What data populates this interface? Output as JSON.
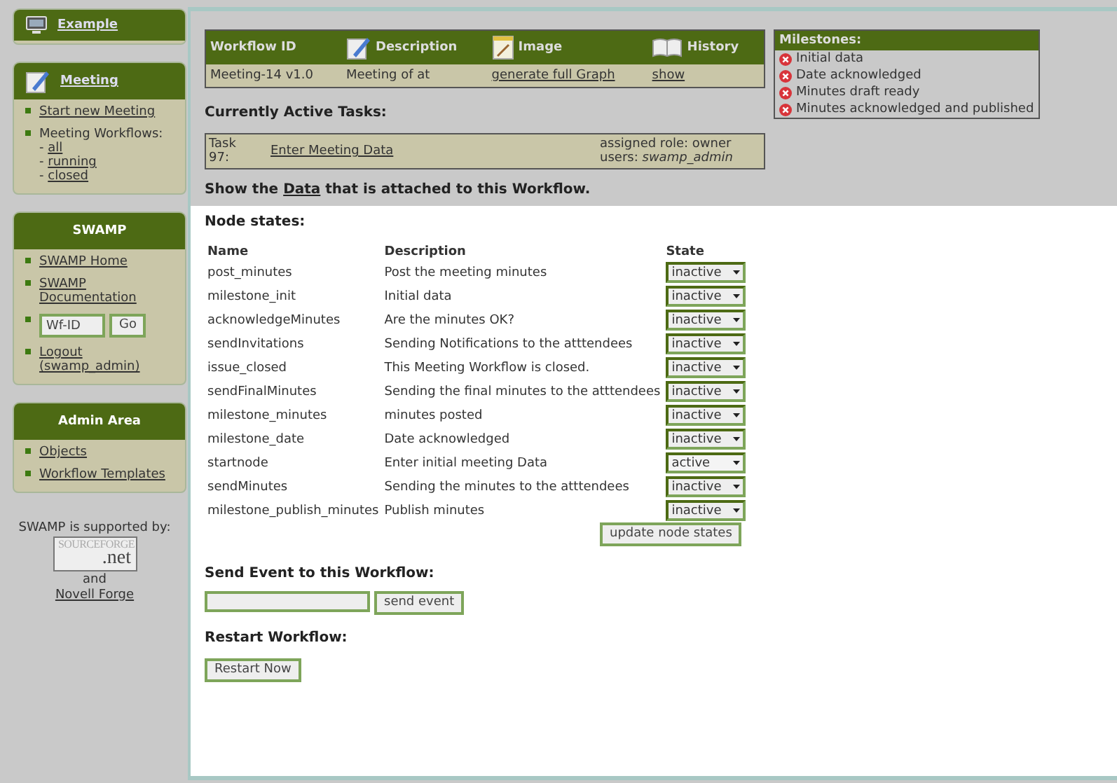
{
  "sidebar": {
    "example_box": {
      "title": "Example"
    },
    "meeting_box": {
      "title": "Meeting",
      "items": [
        {
          "kind": "link",
          "label": "Start new Meeting"
        },
        {
          "kind": "group",
          "label": "Meeting Workflows:",
          "marker": "-",
          "links": [
            "all",
            "running",
            "closed"
          ]
        }
      ]
    },
    "swamp_box": {
      "title": "SWAMP",
      "items": [
        {
          "kind": "link",
          "label": "SWAMP Home"
        },
        {
          "kind": "link",
          "label": "SWAMP Documentation"
        },
        {
          "kind": "form",
          "value": "Wf-ID",
          "button": "Go"
        },
        {
          "kind": "link",
          "label": "Logout (swamp_admin)"
        }
      ]
    },
    "admin_box": {
      "title": "Admin Area",
      "items": [
        {
          "kind": "link",
          "label": "Objects"
        },
        {
          "kind": "link",
          "label": "Workflow Templates"
        }
      ]
    },
    "supporters": {
      "intro": "SWAMP is supported by:",
      "logo_top": "SOURCEFORGE",
      "logo_bottom": ".net",
      "conjunction": "and",
      "link": "Novell Forge"
    }
  },
  "workflow": {
    "columns": [
      "Workflow ID",
      "Description",
      "Image",
      "History"
    ],
    "row": [
      {
        "kind": "text",
        "text": "Meeting-14 v1.0"
      },
      {
        "kind": "text",
        "text": "Meeting of at"
      },
      {
        "kind": "link",
        "text": "generate full Graph"
      },
      {
        "kind": "link",
        "text": "show"
      }
    ]
  },
  "active_tasks": {
    "heading": "Currently Active Tasks:",
    "tasks": [
      {
        "id": "Task 97:",
        "name": "Enter Meeting Data",
        "role": "assigned role: owner",
        "users_label": "users:",
        "users": "swamp_admin"
      }
    ]
  },
  "data_line": {
    "before": "Show the",
    "link": "Data",
    "after": "that is attached to this Workflow."
  },
  "milestones": {
    "title": "Milestones:",
    "items": [
      {
        "label": "Initial data",
        "reached": false
      },
      {
        "label": "Date acknowledged",
        "reached": false
      },
      {
        "label": "Minutes draft ready",
        "reached": false
      },
      {
        "label": "Minutes acknowledged and published",
        "reached": false
      }
    ]
  },
  "node_states": {
    "heading": "Node states:",
    "columns": [
      "Name",
      "Description",
      "State"
    ],
    "rows": [
      {
        "name": "post_minutes",
        "description": "Post the meeting minutes",
        "state": "inactive"
      },
      {
        "name": "milestone_init",
        "description": "Initial data",
        "state": "inactive"
      },
      {
        "name": "acknowledgeMinutes",
        "description": "Are the minutes OK?",
        "state": "inactive"
      },
      {
        "name": "sendInvitations",
        "description": "Sending Notifications to the atttendees",
        "state": "inactive"
      },
      {
        "name": "issue_closed",
        "description": "This Meeting Workflow is closed.",
        "state": "inactive"
      },
      {
        "name": "sendFinalMinutes",
        "description": "Sending the final minutes to the atttendees",
        "state": "inactive"
      },
      {
        "name": "milestone_minutes",
        "description": "minutes posted",
        "state": "inactive"
      },
      {
        "name": "milestone_date",
        "description": "Date acknowledged",
        "state": "inactive"
      },
      {
        "name": "startnode",
        "description": "Enter initial meeting Data",
        "state": "active"
      },
      {
        "name": "sendMinutes",
        "description": "Sending the minutes to the atttendees",
        "state": "inactive"
      },
      {
        "name": "milestone_publish_minutes",
        "description": "Publish minutes",
        "state": "inactive"
      }
    ],
    "update_button": "update node states"
  },
  "send_event": {
    "heading": "Send Event to this Workflow:",
    "button": "send event"
  },
  "restart": {
    "heading": "Restart Workflow:",
    "button": "Restart Now"
  }
}
